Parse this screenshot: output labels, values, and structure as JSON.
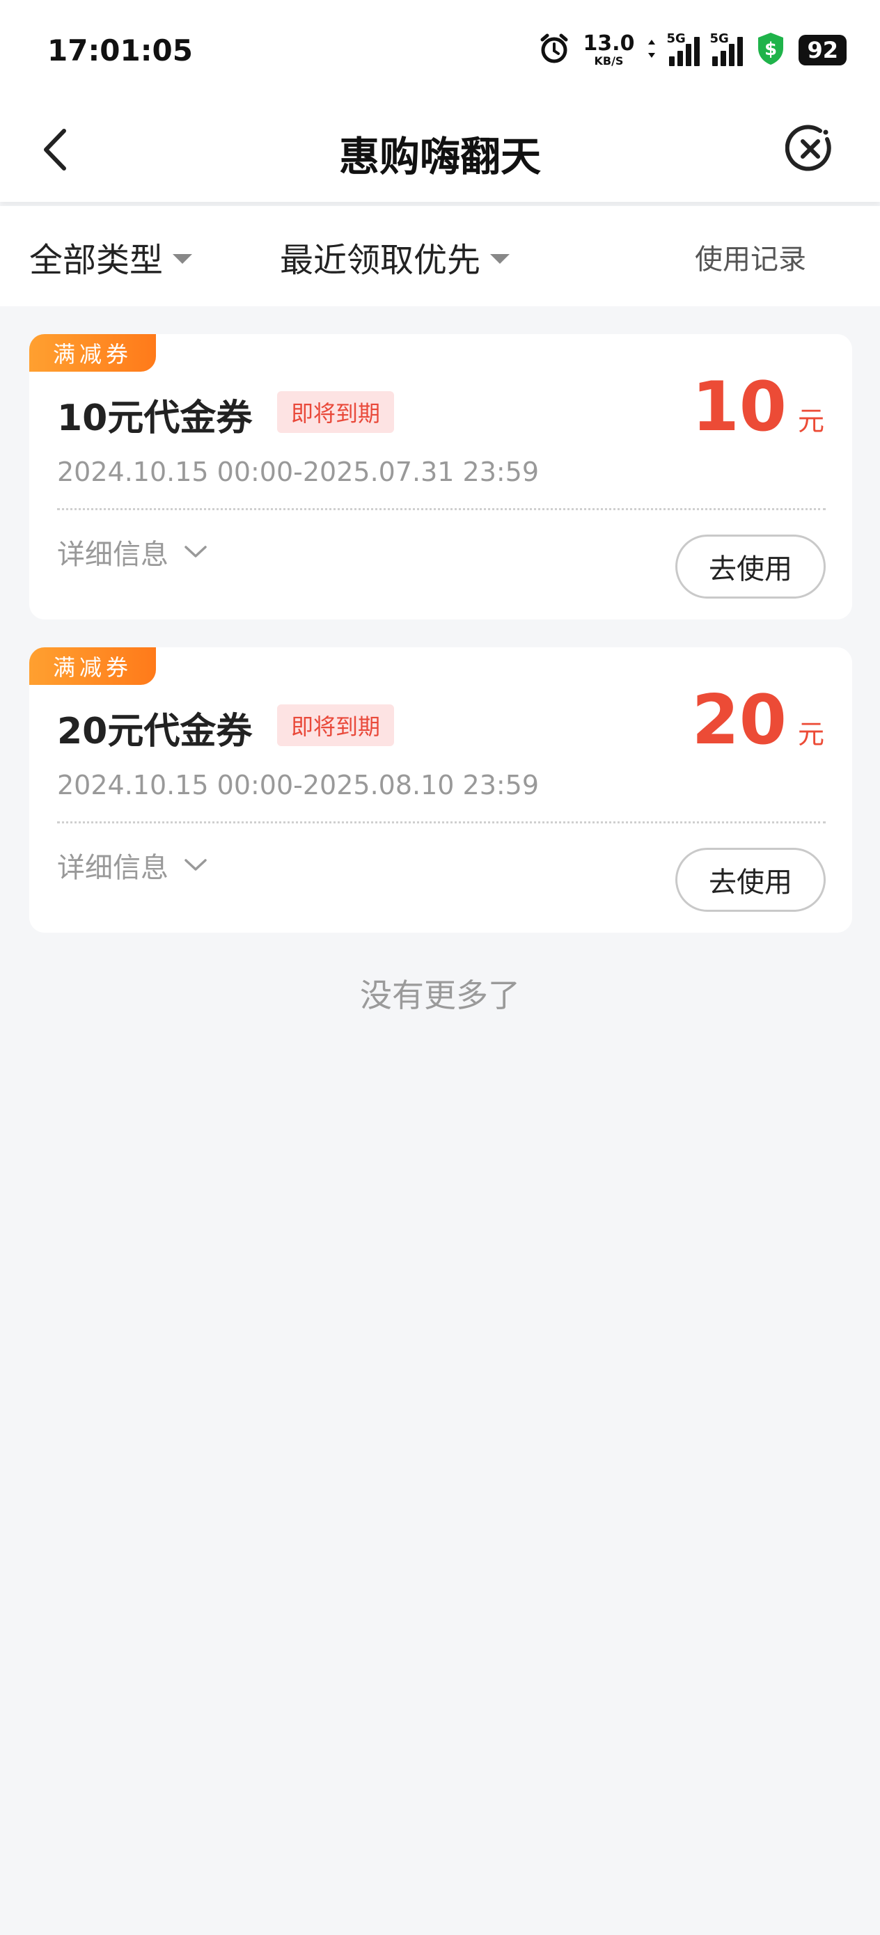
{
  "status_bar": {
    "time": "17:01:05",
    "net_speed": "13.0",
    "net_unit": "KB/S",
    "signal1_label": "5G",
    "signal2_label": "5G",
    "battery": "92"
  },
  "nav": {
    "title": "惠购嗨翻天"
  },
  "filters": {
    "type_label": "全部类型",
    "sort_label": "最近领取优先",
    "usage_record": "使用记录"
  },
  "coupons": [
    {
      "tag": "满减券",
      "name": "10元代金券",
      "badge": "即将到期",
      "amount": "10",
      "unit": "元",
      "period": "2024.10.15 00:00-2025.07.31 23:59",
      "details": "详细信息",
      "action": "去使用"
    },
    {
      "tag": "满减券",
      "name": "20元代金券",
      "badge": "即将到期",
      "amount": "20",
      "unit": "元",
      "period": "2024.10.15 00:00-2025.08.10 23:59",
      "details": "详细信息",
      "action": "去使用"
    }
  ],
  "footer": {
    "no_more": "没有更多了"
  },
  "colors": {
    "accent_red": "#ec4b36",
    "tag_orange": "#ff8a22",
    "background": "#f5f6f8"
  },
  "icons": [
    "alarm-icon",
    "data-arrows-icon",
    "signal-icon",
    "shield-dollar-icon",
    "battery-icon",
    "back-chevron-icon",
    "close-circle-icon",
    "caret-down-icon",
    "chevron-down-icon"
  ]
}
